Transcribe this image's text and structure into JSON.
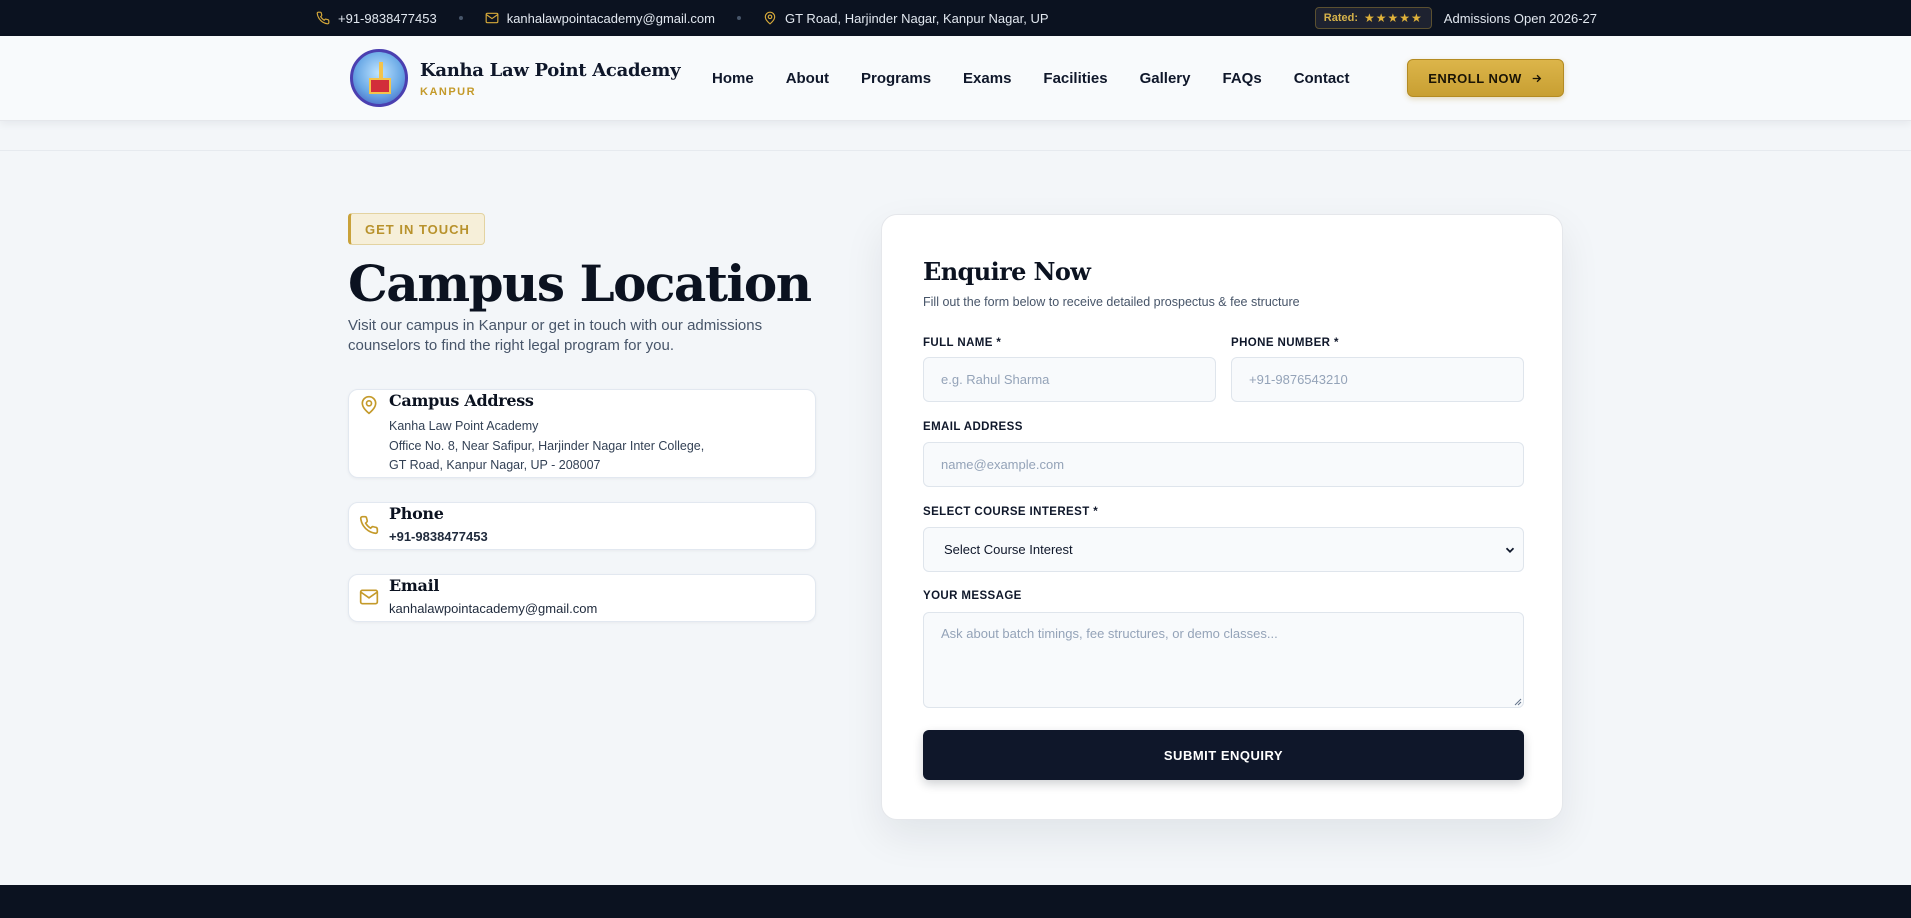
{
  "topbar": {
    "phone": "+91-9838477453",
    "email": "kanhalawpointacademy@gmail.com",
    "address": "GT Road, Harjinder Nagar, Kanpur Nagar, UP",
    "rated_label": "Rated:",
    "stars": "★★★★★",
    "admissions": "Admissions Open 2026-27"
  },
  "header": {
    "brand_name": "Kanha Law Point Academy",
    "brand_sub": "KANPUR",
    "nav": [
      "Home",
      "About",
      "Programs",
      "Exams",
      "Facilities",
      "Gallery",
      "FAQs",
      "Contact"
    ],
    "enroll_label": "ENROLL NOW"
  },
  "contact": {
    "tag": "GET IN TOUCH",
    "title": "Campus Location",
    "lead": "Visit our campus in Kanpur or get in touch with our admissions counselors to find the right legal program for you.",
    "address_card": {
      "title": "Campus Address",
      "lines": [
        "Kanha Law Point Academy",
        "Office No. 8, Near Safipur, Harjinder Nagar Inter College,",
        "GT Road, Kanpur Nagar, UP - 208007"
      ]
    },
    "phone_card": {
      "title": "Phone",
      "value": "+91-9838477453"
    },
    "email_card": {
      "title": "Email",
      "value": "kanhalawpointacademy@gmail.com"
    }
  },
  "form": {
    "title": "Enquire Now",
    "subtitle": "Fill out the form below to receive detailed prospectus & fee structure",
    "full_name": {
      "label": "FULL NAME *",
      "placeholder": "e.g. Rahul Sharma",
      "value": ""
    },
    "phone": {
      "label": "PHONE NUMBER *",
      "placeholder": "+91-9876543210",
      "value": ""
    },
    "email": {
      "label": "EMAIL ADDRESS",
      "placeholder": "name@example.com",
      "value": ""
    },
    "course": {
      "label": "SELECT COURSE INTEREST *",
      "selected": "Select Course Interest"
    },
    "message": {
      "label": "YOUR MESSAGE",
      "placeholder": "Ask about batch timings, fee structures, or demo classes...",
      "value": ""
    },
    "submit_label": "SUBMIT ENQUIRY"
  },
  "colors": {
    "dark": "#0b1220",
    "gold": "#c9a23a",
    "background": "#f3f6f9"
  },
  "icons": [
    "phone-icon",
    "mail-icon",
    "map-pin-icon",
    "star-icon",
    "arrow-right-icon",
    "chevron-down-icon",
    "resize-grip-icon"
  ]
}
